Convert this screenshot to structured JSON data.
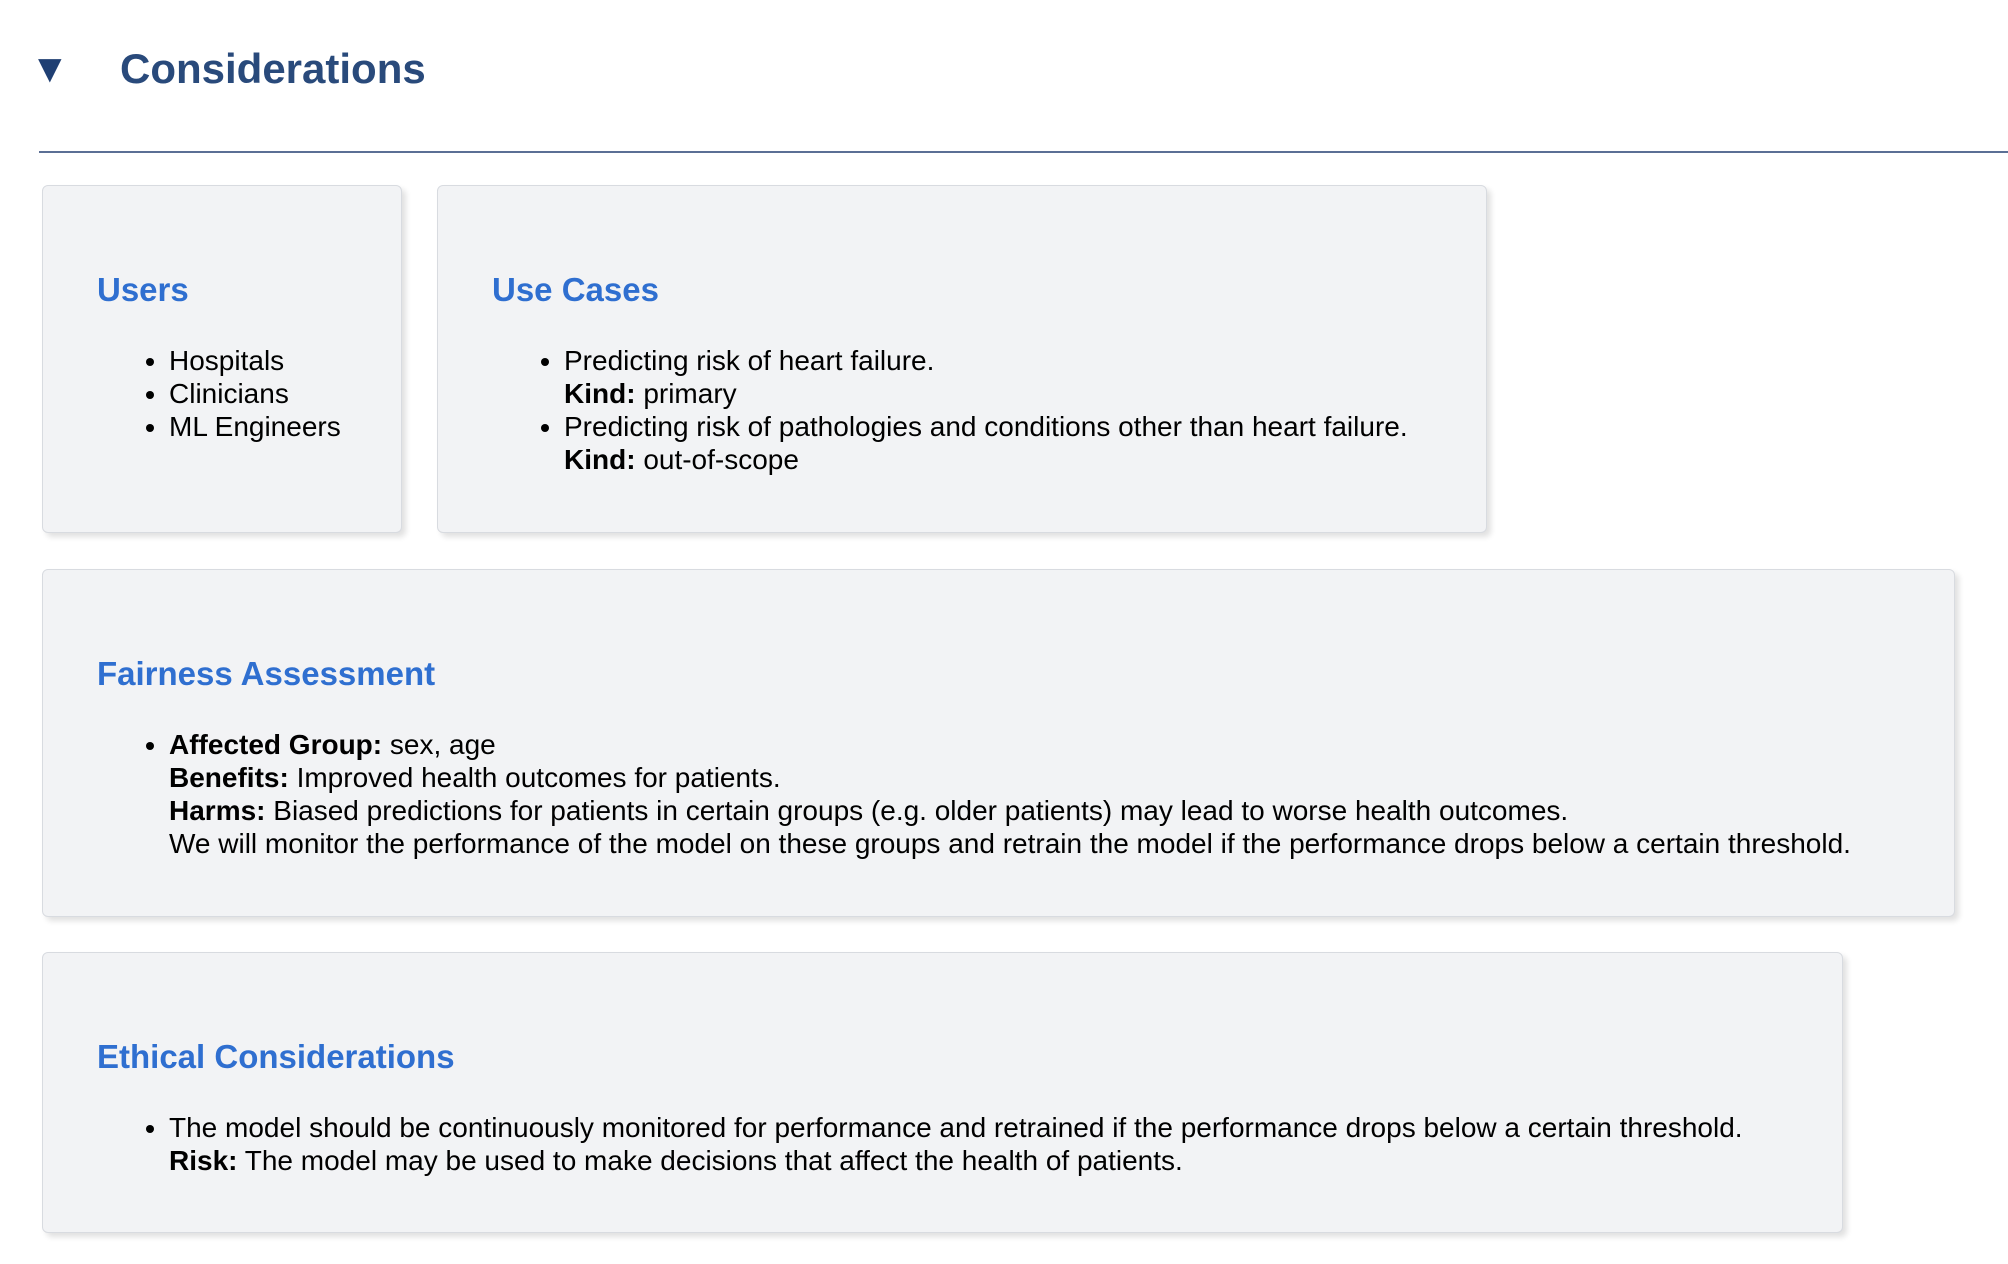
{
  "section": {
    "toggle_icon": "triangle-down-icon",
    "toggle_glyph": "▼",
    "title": "Considerations"
  },
  "users": {
    "title": "Users",
    "items": [
      "Hospitals",
      "Clinicians",
      "ML Engineers"
    ]
  },
  "use_cases": {
    "title": "Use Cases",
    "kind_label": "Kind:",
    "items": [
      {
        "description": "Predicting risk of heart failure.",
        "kind": "primary"
      },
      {
        "description": "Predicting risk of pathologies and conditions other than heart failure.",
        "kind": "out-of-scope"
      }
    ]
  },
  "fairness": {
    "title": "Fairness Assessment",
    "affected_group_label": "Affected Group:",
    "affected_group": "sex, age",
    "benefits_label": "Benefits:",
    "benefits": "Improved health outcomes for patients.",
    "harms_label": "Harms:",
    "harms": "Biased predictions for patients in certain groups (e.g. older patients) may lead to worse health outcomes.",
    "mitigation": "We will monitor the performance of the model on these groups and retrain the model if the performance drops below a certain threshold."
  },
  "ethics": {
    "title": "Ethical Considerations",
    "mitigation": "The model should be continuously monitored for performance and retrained if the performance drops below a certain threshold.",
    "risk_label": "Risk:",
    "risk": "The model may be used to make decisions that affect the health of patients."
  },
  "colors": {
    "header": "#294a7b",
    "card_title": "#2f6fd0",
    "card_background": "#f2f3f5"
  }
}
